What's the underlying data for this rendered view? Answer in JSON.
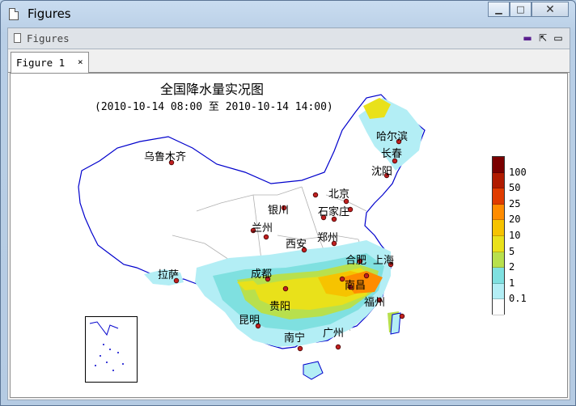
{
  "window": {
    "title": "Figures"
  },
  "inner": {
    "title": "Figures"
  },
  "tab": {
    "label": "Figure 1",
    "close": "×"
  },
  "map": {
    "title": "全国降水量实况图",
    "subtitle": "(2010-10-14 08:00 至 2010-10-14 14:00)",
    "cities": [
      "乌鲁木齐",
      "哈尔滨",
      "长春",
      "沈阳",
      "北京",
      "银川",
      "石家庄",
      "兰州",
      "郑州",
      "西安",
      "合肥",
      "上海",
      "拉萨",
      "成都",
      "南昌",
      "贵阳",
      "福州",
      "昆明",
      "南宁",
      "广州"
    ]
  },
  "legend": {
    "ticks": [
      "100",
      "50",
      "25",
      "20",
      "10",
      "5",
      "2",
      "1",
      "0.1"
    ],
    "colors": [
      "#7a0000",
      "#b01b00",
      "#e03c00",
      "#ff8c00",
      "#f6c300",
      "#e9e11a",
      "#b8e04d",
      "#7fe0e0",
      "#b3eef5",
      "#ffffff"
    ]
  }
}
